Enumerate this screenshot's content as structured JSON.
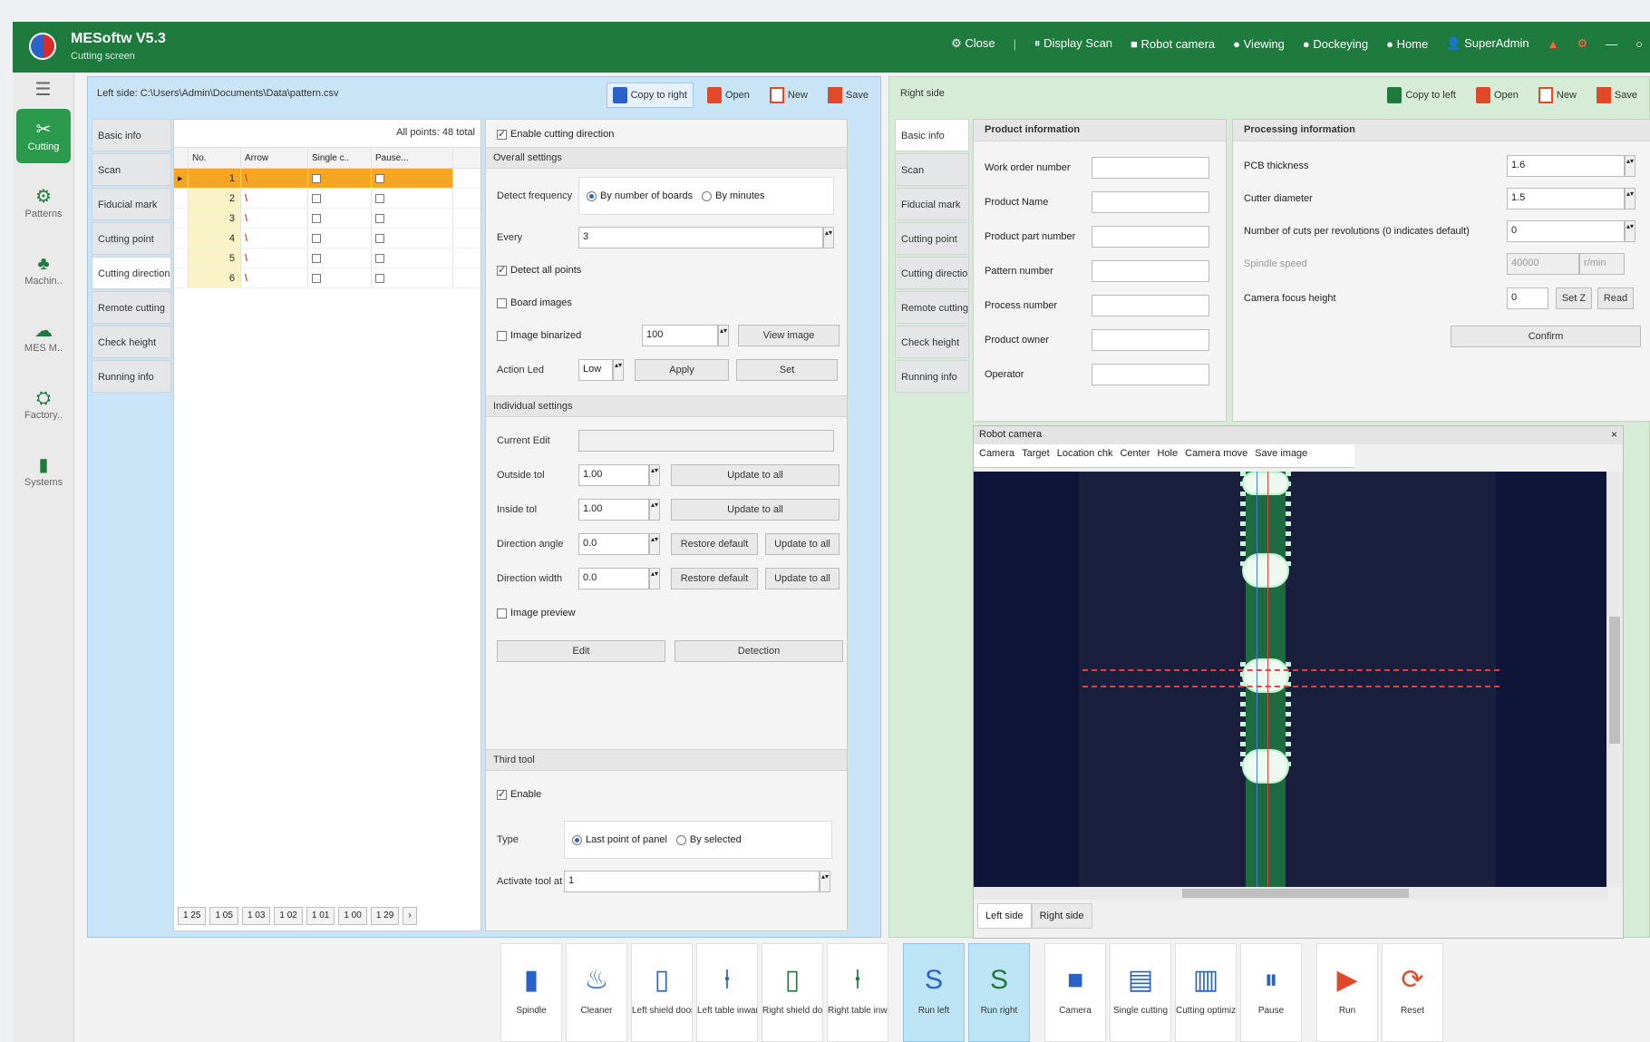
{
  "titlebar": {
    "title": "MESoftw V5.3",
    "subtitle": "Cutting screen",
    "menu": [
      "Close",
      "|",
      "Display Scan",
      "Robot camera",
      "Viewing",
      "Dockeying",
      "Home",
      "SuperAdmin"
    ]
  },
  "leftnav": {
    "menu_icon": "☰",
    "items": [
      {
        "label": "Cutting",
        "icon": "cutting-icon"
      },
      {
        "label": "Patterns",
        "icon": "pattern-icon"
      },
      {
        "label": "Machin..",
        "icon": "machine-icon"
      },
      {
        "label": "MES M..",
        "icon": "cloud-icon"
      },
      {
        "label": "Factory..",
        "icon": "factory-icon"
      },
      {
        "label": "Systems",
        "icon": "chart-icon"
      }
    ]
  },
  "left": {
    "path": "Left side: C:\\Users\\Admin\\Documents\\Data\\pattern.csv",
    "buttons": {
      "copy": "Copy to right",
      "open": "Open",
      "new": "New",
      "save": "Save"
    },
    "subtabs": [
      "Basic info",
      "Scan",
      "Fiducial mark",
      "Cutting point",
      "Cutting direction",
      "Remote cutting",
      "Check height",
      "Running info"
    ],
    "table": {
      "info": "All points: 48 total",
      "headers": [
        "No.",
        "Arrow",
        "Single c..",
        "Pause..."
      ],
      "rows": [
        {
          "no": "1",
          "arrow": "\\",
          "selected": true
        },
        {
          "no": "2",
          "arrow": "\\"
        },
        {
          "no": "3",
          "arrow": "\\"
        },
        {
          "no": "4",
          "arrow": "\\"
        },
        {
          "no": "5",
          "arrow": "\\"
        },
        {
          "no": "6",
          "arrow": "\\"
        }
      ],
      "pager": [
        "1 25",
        "1 05",
        "1 03",
        "1 02",
        "1 01",
        "1 00",
        "1 29",
        "›"
      ]
    },
    "settings": {
      "enable_label": "Enable cutting direction",
      "overall_header": "Overall settings",
      "detect_frequency_label": "Detect frequency",
      "radio1": "By number of boards",
      "radio2": "By minutes",
      "every_label": "Every",
      "every_value": "3",
      "chk_detect_all": "Detect all points",
      "chk_board_images": "Board images",
      "chk_image_binarized": "Image binarized",
      "binarized_value": "100",
      "view_image": "View image",
      "action_label": "Action Led",
      "action_value": "Low",
      "apply": "Apply",
      "set": "Set",
      "individual_header": "Individual settings",
      "current_edit_label": "Current Edit",
      "outside_tol_label": "Outside tol",
      "outside_tol_value": "1.00",
      "inside_tol_label": "Inside tol",
      "inside_tol_value": "1.00",
      "update_to_all": "Update to all",
      "direction_angle_label": "Direction angle",
      "direction_angle_value": "0.0",
      "direction_width_label": "Direction width",
      "direction_width_value": "0.0",
      "restore_default": "Restore default",
      "update_all": "Update to all",
      "chk_image_preview": "Image preview",
      "edit": "Edit",
      "detection": "Detection",
      "third_header": "Third tool",
      "chk_enable": "Enable",
      "type_label": "Type",
      "type_radio1": "Last point of panel",
      "type_radio2": "By selected",
      "activate_label": "Activate tool at",
      "activate_value": "1"
    }
  },
  "right": {
    "title": "Right side",
    "buttons": {
      "copy": "Copy to left",
      "open": "Open",
      "new": "New",
      "save": "Save"
    },
    "subtabs": [
      "Basic info",
      "Scan",
      "Fiducial mark",
      "Cutting point",
      "Cutting direction",
      "Remote cutting",
      "Check height",
      "Running info"
    ],
    "basic": {
      "header": "Product information",
      "fields": [
        "Work order number",
        "Product Name",
        "Product part number",
        "Pattern number",
        "Process number",
        "Product owner",
        "Operator"
      ]
    },
    "process": {
      "header": "Processing information",
      "pcb_label": "PCB thickness",
      "pcb_value": "1.6",
      "cutter_label": "Cutter diameter",
      "cutter_value": "1.5",
      "num_label": "Number of cuts per revolutions (0 indicates default)",
      "num_value": "0",
      "spindle_label": "Spindle speed",
      "spindle_value": "40000",
      "spindle_unit": "r/min",
      "camera_label": "Camera focus height",
      "camera_value": "0",
      "set_btn": "Set Z",
      "read_btn": "Read",
      "confirm": "Confirm"
    },
    "camera": {
      "title": "Robot camera",
      "tabs": [
        "Camera",
        "Target",
        "Location chk",
        "Center",
        "Hole",
        "Camera move",
        "Save image"
      ],
      "side_tabs": [
        "Left side",
        "Right side"
      ]
    }
  },
  "toolbar": [
    {
      "label": "Spindle",
      "icon": "spindle-icon",
      "glyph": "▮",
      "color": "#2b62c9"
    },
    {
      "label": "Cleaner",
      "icon": "cleaner-icon",
      "glyph": "♨",
      "color": "#2b62c9"
    },
    {
      "label": "Left shield door",
      "icon": "door-icon",
      "glyph": "▯",
      "color": "#2b62c9"
    },
    {
      "label": "Left table inward",
      "icon": "table-icon",
      "glyph": "⍿",
      "color": "#2b62c9"
    },
    {
      "label": "Right shield door",
      "icon": "door-icon",
      "glyph": "▯",
      "color": "#1f7a3d"
    },
    {
      "label": "Right table inward",
      "icon": "table-icon",
      "glyph": "⍿",
      "color": "#1f7a3d"
    },
    {
      "label": "Run left",
      "icon": "run-left-icon",
      "glyph": "S",
      "color": "#2b62c9",
      "highlight": true
    },
    {
      "label": "Run right",
      "icon": "run-right-icon",
      "glyph": "S",
      "color": "#1f7a3d",
      "highlight": true
    },
    {
      "label": "Camera",
      "icon": "camera-icon",
      "glyph": "■",
      "color": "#2b62c9"
    },
    {
      "label": "Single cutting",
      "icon": "single-cut-icon",
      "glyph": "▤",
      "color": "#2b62c9"
    },
    {
      "label": "Cutting optimized",
      "icon": "optimize-icon",
      "glyph": "▥",
      "color": "#2b62c9"
    },
    {
      "label": "Pause",
      "icon": "pause-icon",
      "glyph": "⏸",
      "color": "#2b62c9"
    },
    {
      "label": "Run",
      "icon": "run-icon",
      "glyph": "▶",
      "color": "#e04a2a"
    },
    {
      "label": "Reset",
      "icon": "reset-icon",
      "glyph": "⟳",
      "color": "#e04a2a"
    }
  ]
}
